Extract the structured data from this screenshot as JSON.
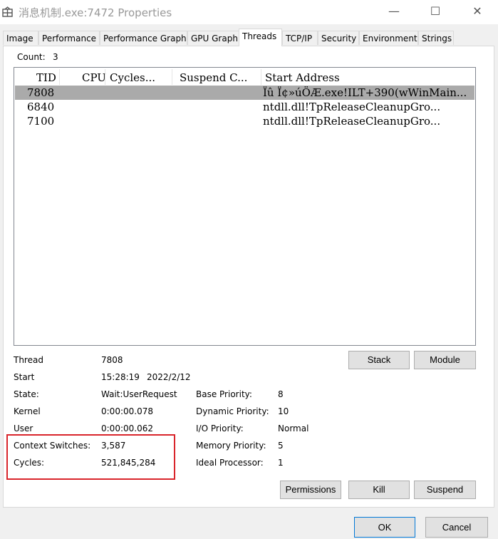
{
  "window": {
    "title": "消息机制.exe:7472 Properties",
    "minimize_glyph": "—",
    "maximize_glyph": "☐",
    "close_glyph": "✕"
  },
  "tabs": [
    {
      "label": "Image"
    },
    {
      "label": "Performance"
    },
    {
      "label": "Performance Graph"
    },
    {
      "label": "GPU Graph"
    },
    {
      "label": "Threads",
      "active": true
    },
    {
      "label": "TCP/IP"
    },
    {
      "label": "Security"
    },
    {
      "label": "Environment"
    },
    {
      "label": "Strings"
    }
  ],
  "threads": {
    "count_label": "Count:",
    "count_value": "3",
    "columns": [
      "TID",
      "CPU",
      "Cycles...",
      "Suspend C...",
      "Start Address"
    ],
    "rows": [
      {
        "tid": "7808",
        "cpu": "",
        "cycles": "",
        "suspend": "",
        "start": "Ïû Ï¢»úÖÆ.exe!ILT+390(wWinMain...",
        "selected": true
      },
      {
        "tid": "6840",
        "cpu": "",
        "cycles": "",
        "suspend": "",
        "start": "ntdll.dll!TpReleaseCleanupGro..."
      },
      {
        "tid": "7100",
        "cpu": "",
        "cycles": "",
        "suspend": "",
        "start": "ntdll.dll!TpReleaseCleanupGro..."
      }
    ]
  },
  "details": {
    "thread_label": "Thread",
    "thread_value": "7808",
    "start_label": "Start",
    "start_time": "15:28:19",
    "start_date": "2022/2/12",
    "state_label": "State:",
    "state_value": "Wait:UserRequest",
    "kernel_label": "Kernel",
    "kernel_value": "0:00:00.078",
    "user_label": "User",
    "user_value": "0:00:00.062",
    "ctx_label": "Context Switches:",
    "ctx_value": "3,587",
    "cycles_label": "Cycles:",
    "cycles_value": "521,845,284",
    "base_priority_label": "Base Priority:",
    "base_priority_value": "8",
    "dynamic_priority_label": "Dynamic Priority:",
    "dynamic_priority_value": "10",
    "io_priority_label": "I/O Priority:",
    "io_priority_value": "Normal",
    "memory_priority_label": "Memory Priority:",
    "memory_priority_value": "5",
    "ideal_processor_label": "Ideal Processor:",
    "ideal_processor_value": "1"
  },
  "buttons": {
    "stack": "Stack",
    "module": "Module",
    "permissions": "Permissions",
    "kill": "Kill",
    "suspend": "Suspend",
    "ok": "OK",
    "cancel": "Cancel"
  },
  "colors": {
    "selected_row": "#aaaaaa",
    "highlight_box": "#d9252b",
    "ok_border": "#0078d7"
  }
}
